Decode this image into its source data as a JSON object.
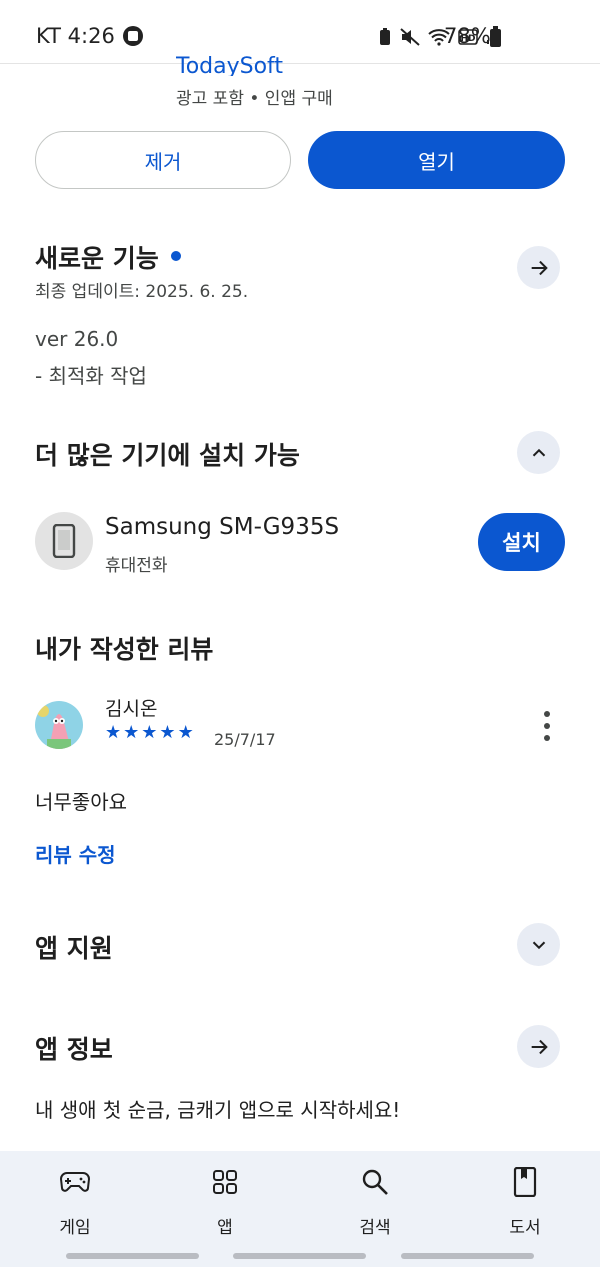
{
  "status_bar": {
    "carrier_time": "KT 4:26",
    "battery": "78%"
  },
  "app_header": {
    "developer": "TodaySoft",
    "meta": "광고 포함 • 인앱 구매"
  },
  "actions": {
    "uninstall_label": "제거",
    "open_label": "열기"
  },
  "whats_new": {
    "title": "새로운 기능",
    "updated": "최종 업데이트: 2025. 6. 25.",
    "notes": [
      "ver 26.0",
      "- 최적화 작업"
    ]
  },
  "more_devices": {
    "title": "더 많은 기기에 설치 가능",
    "device_name": "Samsung SM-G935S",
    "device_type": "휴대전화",
    "install_label": "설치"
  },
  "my_review": {
    "title": "내가 작성한 리뷰",
    "reviewer": "김시온",
    "rating": 5,
    "date": "25/7/17",
    "text": "너무좋아요",
    "edit_label": "리뷰 수정"
  },
  "app_support": {
    "title": "앱 지원"
  },
  "app_info": {
    "title": "앱 정보",
    "description": "내 생애 첫 순금, 금캐기 앱으로 시작하세요!"
  },
  "bottom_nav": {
    "items": [
      {
        "label": "게임",
        "icon": "gamepad-icon"
      },
      {
        "label": "앱",
        "icon": "apps-grid-icon"
      },
      {
        "label": "검색",
        "icon": "search-icon"
      },
      {
        "label": "도서",
        "icon": "book-icon"
      }
    ]
  },
  "colors": {
    "accent": "#0b57d0",
    "nav_background": "#eef2f8"
  }
}
